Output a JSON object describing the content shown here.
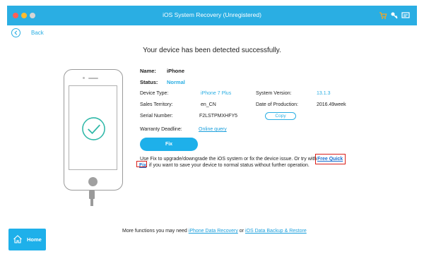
{
  "window": {
    "title": "iOS System Recovery (Unregistered)",
    "toolbar_icons": [
      "cart-icon",
      "key-icon",
      "feedback-icon"
    ]
  },
  "nav": {
    "back_label": "Back"
  },
  "headline": "Your device has been detected successfully.",
  "device": {
    "name_label": "Name:",
    "name_value": "iPhone",
    "status_label": "Status:",
    "status_value": "Normal",
    "device_type_label": "Device Type:",
    "device_type_value": "iPhone 7 Plus",
    "system_version_label": "System Version:",
    "system_version_value": "13.1.3",
    "sales_territory_label": "Sales Territory:",
    "sales_territory_value": "en_CN",
    "production_date_label": "Date of Production:",
    "production_date_value": "2016.49week",
    "serial_label": "Serial Number:",
    "serial_value": "F2LSTPMXHFY5",
    "copy_label": "Copy",
    "warranty_label": "Warranty Deadline:",
    "warranty_link": "Online query"
  },
  "actions": {
    "fix_label": "Fix",
    "description_part1": "Use Fix to upgrade/downgrade the iOS system or fix the device issue. Or try with",
    "free_quick_fix_part1": "Free Quick",
    "free_quick_fix_part2": "Fix",
    "description_part2": "if you want to save your device to normal status without further operation."
  },
  "footer": {
    "home_label": "Home",
    "more_text": "More functions you may need",
    "link1": "iPhone Data Recovery",
    "or_text": "or",
    "link2": "iOS Data Backup & Restore"
  },
  "colors": {
    "accent": "#2aaee3",
    "button": "#1eb0ea",
    "highlight": "#d9201b"
  }
}
